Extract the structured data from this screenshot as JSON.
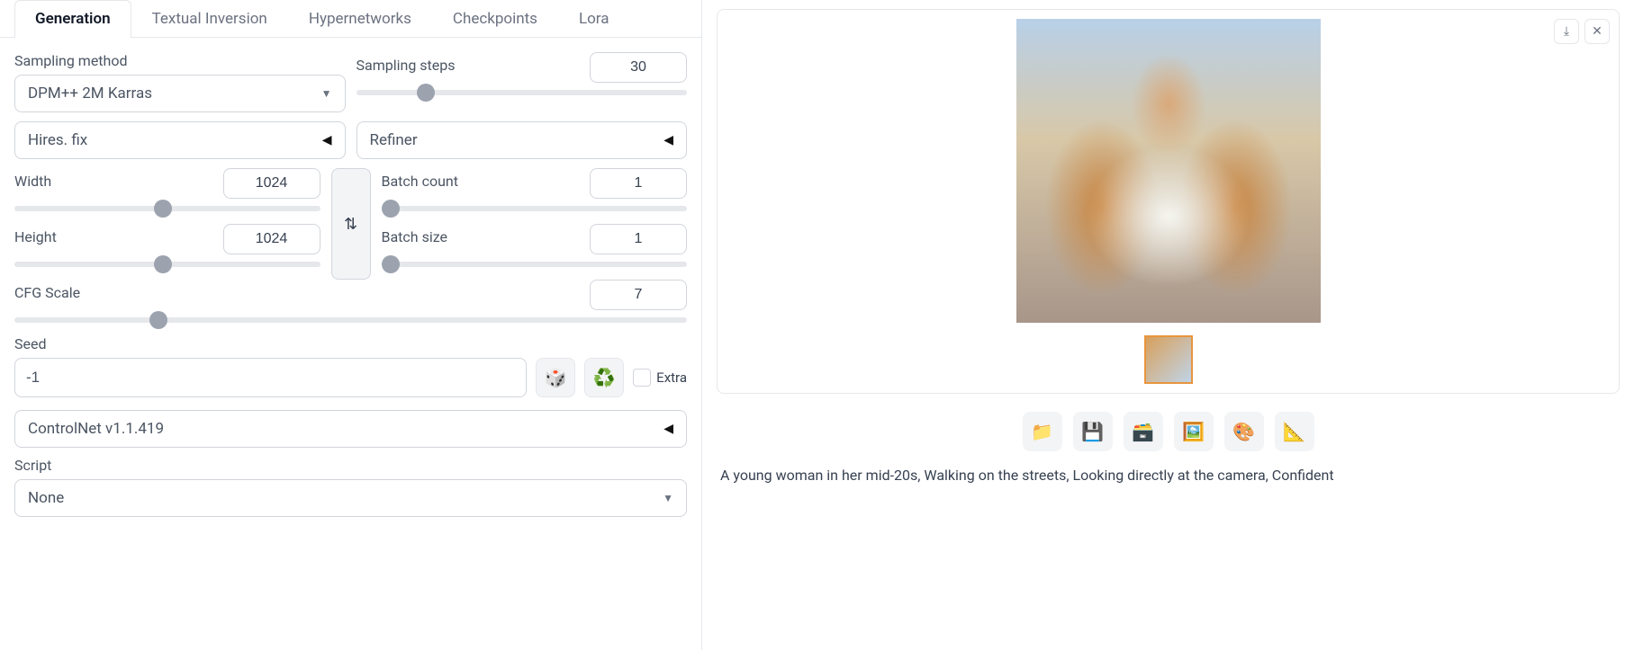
{
  "tabs": [
    "Generation",
    "Textual Inversion",
    "Hypernetworks",
    "Checkpoints",
    "Lora"
  ],
  "active_tab": 0,
  "sampling": {
    "method_label": "Sampling method",
    "method_value": "DPM++ 2M Karras",
    "steps_label": "Sampling steps",
    "steps_value": "30"
  },
  "hires_label": "Hires. fix",
  "refiner_label": "Refiner",
  "width": {
    "label": "Width",
    "value": "1024"
  },
  "height": {
    "label": "Height",
    "value": "1024"
  },
  "batch_count": {
    "label": "Batch count",
    "value": "1"
  },
  "batch_size": {
    "label": "Batch size",
    "value": "1"
  },
  "cfg": {
    "label": "CFG Scale",
    "value": "7"
  },
  "seed": {
    "label": "Seed",
    "value": "-1",
    "extra_label": "Extra"
  },
  "controlnet_label": "ControlNet v1.1.419",
  "script": {
    "label": "Script",
    "value": "None"
  },
  "action_icons": {
    "folder": "📁",
    "save": "💾",
    "zip": "🗃️",
    "image": "🖼️",
    "palette": "🎨",
    "ruler": "📐"
  },
  "seed_icons": {
    "dice": "🎲",
    "recycle": "♻️"
  },
  "swap_icon": "⇅",
  "download_icon": "⤓",
  "close_icon": "✕",
  "prompt_text": "A young woman in her mid-20s, Walking on the streets, Looking directly at the camera, Confident"
}
